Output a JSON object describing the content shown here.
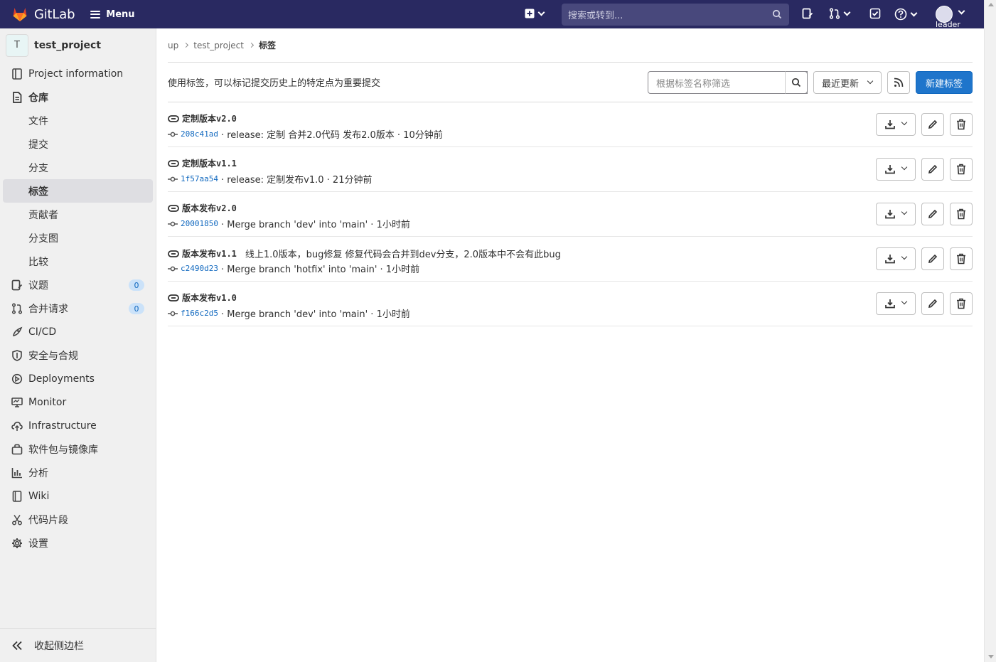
{
  "header": {
    "brand": "GitLab",
    "menu_label": "Menu",
    "search_placeholder": "搜索或转到...",
    "user_label": "leader",
    "colors": {
      "bar": "#292961",
      "accent": "#1f75cb"
    }
  },
  "sidebar": {
    "project_initial": "T",
    "project_name": "test_project",
    "items": [
      {
        "label": "Project information",
        "icon": "project-info-icon"
      },
      {
        "label": "仓库",
        "icon": "repository-icon"
      },
      {
        "label": "议题",
        "icon": "issues-icon",
        "badge": "0"
      },
      {
        "label": "合并请求",
        "icon": "merge-request-icon",
        "badge": "0"
      },
      {
        "label": "CI/CD",
        "icon": "rocket-icon"
      },
      {
        "label": "安全与合规",
        "icon": "shield-icon"
      },
      {
        "label": "Deployments",
        "icon": "deployments-icon"
      },
      {
        "label": "Monitor",
        "icon": "monitor-icon"
      },
      {
        "label": "Infrastructure",
        "icon": "cloud-icon"
      },
      {
        "label": "软件包与镜像库",
        "icon": "package-icon"
      },
      {
        "label": "分析",
        "icon": "chart-icon"
      },
      {
        "label": "Wiki",
        "icon": "book-icon"
      },
      {
        "label": "代码片段",
        "icon": "snippet-icon"
      },
      {
        "label": "设置",
        "icon": "gear-icon"
      }
    ],
    "sub_items": [
      "文件",
      "提交",
      "分支",
      "标签",
      "贡献者",
      "分支图",
      "比较"
    ],
    "active_sub": "标签",
    "collapse_label": "收起侧边栏"
  },
  "breadcrumb": {
    "root": "up",
    "project": "test_project",
    "current": "标签"
  },
  "toolbar": {
    "description": "使用标签，可以标记提交历史上的特定点为重要提交",
    "filter_placeholder": "根据标签名称筛选",
    "sort_label": "最近更新",
    "new_tag_label": "新建标签"
  },
  "tags": [
    {
      "name": "定制版本v2.0",
      "message": "",
      "sha": "208c41ad",
      "commit": "· release: 定制 合并2.0代码 发布2.0版本 · 10分钟前"
    },
    {
      "name": "定制版本v1.1",
      "message": "",
      "sha": "1f57aa54",
      "commit": "· release: 定制发布v1.0 · 21分钟前"
    },
    {
      "name": "版本发布v2.0",
      "message": "",
      "sha": "20001850",
      "commit": "· Merge branch 'dev' into 'main' · 1小时前"
    },
    {
      "name": "版本发布v1.1",
      "message": "线上1.0版本，bug修复 修复代码会合并到dev分支，2.0版本中不会有此bug",
      "sha": "c2490d23",
      "commit": "· Merge branch 'hotfix' into 'main' · 1小时前"
    },
    {
      "name": "版本发布v1.0",
      "message": "",
      "sha": "f166c2d5",
      "commit": "· Merge branch 'dev' into 'main' · 1小时前"
    }
  ]
}
